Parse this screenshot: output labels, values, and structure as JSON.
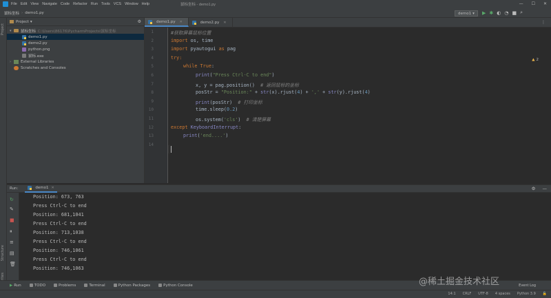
{
  "menubar": {
    "items": [
      "File",
      "Edit",
      "View",
      "Navigate",
      "Code",
      "Refactor",
      "Run",
      "Tools",
      "VCS",
      "Window",
      "Help"
    ],
    "title": "鼠标坐标 - demo1.py"
  },
  "navbar": {
    "project": "鼠标坐标",
    "file": "demo1.py",
    "run_config": "demo1"
  },
  "project_panel": {
    "header": "Project",
    "root_name": "鼠标坐标",
    "root_path": "C:\\Users\\86176\\PycharmProjects\\鼠标坐标",
    "files": [
      "demo1.py",
      "demo2.py",
      "python.png",
      "鼠标.exe"
    ],
    "external": "External Libraries",
    "scratches": "Scratches and Consoles"
  },
  "editor": {
    "tabs": [
      "demo1.py",
      "demo2.py"
    ],
    "warning_count": "2",
    "line_numbers": [
      "1",
      "2",
      "3",
      "4",
      "5",
      "6",
      "7",
      "8",
      "9",
      "10",
      "11",
      "12",
      "13",
      "14"
    ],
    "lines": {
      "l1": "#获取屏幕鼠标位置",
      "l2_kw": "import",
      "l2_rest": " os, time",
      "l3_kw": "import",
      "l3_mid": " pyautogui ",
      "l3_as": "as",
      "l3_rest": " pag",
      "l4": "try:",
      "l5_kw": "while",
      "l5_true": " True",
      "l5_colon": ":",
      "l6_fn": "print",
      "l6_str": "\"Press Ctrl-C to end\"",
      "l7_code": "x, y = pag.position()  ",
      "l7_cm": "# 返回鼠标的坐标",
      "l8_a": "posStr = ",
      "l8_s1": "\"Position:\"",
      "l8_b": " + ",
      "l8_str": "str",
      "l8_c": "(x).rjust(",
      "l8_n1": "4",
      "l8_d": ") + ",
      "l8_s2": "','",
      "l8_e": " + ",
      "l8_str2": "str",
      "l8_f": "(y).rjust(",
      "l8_n2": "4",
      "l8_g": ")",
      "l9_fn": "print",
      "l9_rest": "(posStr)  ",
      "l9_cm": "# 打印坐标",
      "l10_a": "time.sleep(",
      "l10_n": "0.2",
      "l10_b": ")",
      "l11_a": "os.system(",
      "l11_s": "'cls'",
      "l11_b": ")  ",
      "l11_cm": "# 清楚屏幕",
      "l12_kw": "except",
      "l12_cls": " KeyboardInterrupt",
      "l12_colon": ":",
      "l13_fn": "print",
      "l13_str": "'end....'"
    }
  },
  "run": {
    "label": "Run:",
    "tab": "demo1",
    "output": [
      "Position: 673, 763",
      "Press Ctrl-C to end",
      "Position: 681,1041",
      "Press Ctrl-C to end",
      "Position: 713,1038",
      "Press Ctrl-C to end",
      "Position: 746,1061",
      "Press Ctrl-C to end",
      "Position: 746,1063"
    ]
  },
  "left_stripe": {
    "project": "Project",
    "structure": "Structure",
    "favorites": "Favorites"
  },
  "toolwindows": [
    "Run",
    "TODO",
    "Problems",
    "Terminal",
    "Python Packages",
    "Python Console"
  ],
  "event_log": "Event Log",
  "status": {
    "pos": "14:1",
    "eol": "CRLF",
    "enc": "UTF-8",
    "indent": "4 spaces",
    "interp": "Python 3.9"
  },
  "watermark": "@稀土掘金技术社区"
}
